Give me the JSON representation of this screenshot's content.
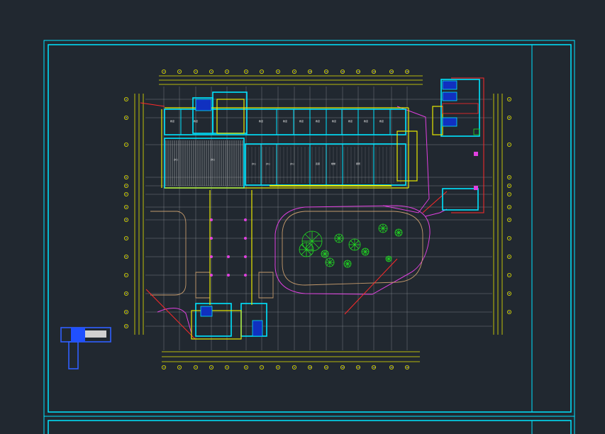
{
  "app": {
    "title": ""
  },
  "drawing": {
    "type": "CAD floor plan (school building, first floor)",
    "background": "#212830",
    "colors": {
      "frame": "#00e5ff",
      "wall": "#00e5ff",
      "dimension": "#e8e800",
      "grid": "#c8c8c8",
      "magenta": "#e040e0",
      "red": "#ff2a2a",
      "green": "#22dd22",
      "blue": "#3060ff",
      "hatch": "#e0e0e0",
      "brown": "#c49a6c"
    },
    "grid_columns_top": [
      "1",
      "2",
      "3",
      "4",
      "5",
      "6",
      "7",
      "8",
      "9",
      "10",
      "11",
      "12",
      "13",
      "14",
      "15",
      "16"
    ],
    "grid_columns_bottom": [
      "1",
      "2",
      "3",
      "4",
      "5",
      "6",
      "7",
      "8",
      "9",
      "10",
      "11",
      "12",
      "13",
      "14",
      "15",
      "16"
    ],
    "grid_rows_left": [
      "A",
      "B",
      "C",
      "D",
      "E",
      "F",
      "G",
      "H",
      "J",
      "K",
      "L",
      "M",
      "N",
      "P"
    ],
    "grid_rows_right": [
      "A",
      "B",
      "C",
      "D",
      "E",
      "F",
      "G",
      "H",
      "J",
      "K",
      "L",
      "M",
      "N"
    ],
    "room_labels": [
      "教室",
      "教室",
      "教室",
      "教室",
      "教室",
      "教室",
      "教室",
      "教室",
      "教室",
      "教室",
      "办公",
      "办公",
      "办公",
      "办公",
      "办公",
      "走廊",
      "楼梯",
      "厕所"
    ]
  }
}
